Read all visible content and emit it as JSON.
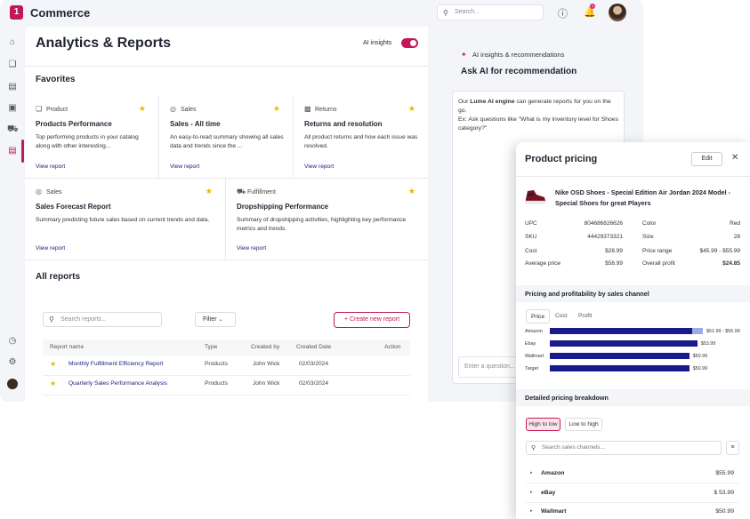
{
  "app": {
    "title": "Commerce",
    "logo_char": "1",
    "search_placeholder": "Search...",
    "notification_count": "1"
  },
  "page": {
    "title": "Analytics & Reports",
    "ai_insights_label": "AI insights",
    "ai_insights_on": true
  },
  "favorites": {
    "title": "Favorites",
    "cards": [
      {
        "category": "Product",
        "icon": "box-icon",
        "title": "Products Performance",
        "desc": "Top performing products in your catalog along with other interesting...",
        "link": "View report"
      },
      {
        "category": "Sales",
        "icon": "target-icon",
        "title": "Sales - All time",
        "desc": "An easy-to-read summary showing all sales data and trends since the ...",
        "link": "View report"
      },
      {
        "category": "Returns",
        "icon": "bank-icon",
        "title": "Returns and resolution",
        "desc": "All product returns and how each issue was resolved.",
        "link": "View report"
      },
      {
        "category": "Sales",
        "icon": "target-icon",
        "title": "Sales Forecast Report",
        "desc": "Summary predicting future sales based on current trends and data.",
        "link": "View report"
      },
      {
        "category": "Fulfillment",
        "icon": "truck-icon",
        "title": "Dropshipping Performance",
        "desc": "Summary of dropshipping activities, highlighting key performance metrics and trends.",
        "link": "View report"
      }
    ]
  },
  "all_reports": {
    "title": "All reports",
    "search_placeholder": "Search reports...",
    "filter_label": "Filter",
    "new_label": "+ Create new report",
    "columns": [
      "Report name",
      "Type",
      "Created by",
      "Created Date",
      "Action"
    ],
    "rows": [
      {
        "name": "Monthly Fulfillment Efficiency Report",
        "type": "Products",
        "by": "John Wick",
        "date": "02/03/2024"
      },
      {
        "name": "Quarterly Sales Performance Analysis",
        "type": "Products",
        "by": "John Wick",
        "date": "02/03/2024"
      }
    ]
  },
  "ai_panel": {
    "header": "AI insights & recommendations",
    "title": "Ask AI for recommendation",
    "msg_prefix": "Our ",
    "msg_bold": "Lume AI engine",
    "msg_rest": " can generate reports for you on the go.",
    "msg_example": "Ex: Ask questions like \"What is my inventory level for Shoes category?\"",
    "input_placeholder": "Enter a question..."
  },
  "product_pricing": {
    "title": "Product pricing",
    "edit_label": "Edit",
    "product_name": "Nike OSD Shoes - Special Edition Air Jordan 2024 Model - Special Shoes for great Players",
    "left_kv": [
      {
        "k": "UPC",
        "v": "804686826626"
      },
      {
        "k": "SKU",
        "v": "44429373321"
      },
      {
        "k": "Cost",
        "v": "$28.99"
      },
      {
        "k": "Average price",
        "v": "$58.99"
      }
    ],
    "right_kv": [
      {
        "k": "Color",
        "v": "Red"
      },
      {
        "k": "Size",
        "v": "28"
      },
      {
        "k": "Price range",
        "v": "$45.99 - $55.99"
      },
      {
        "k": "Overall profit",
        "v": "$24.85"
      }
    ],
    "channel_title": "Pricing and profitability by sales channel",
    "tabs": [
      "Price",
      "Cost",
      "Profit"
    ],
    "active_tab": "Price",
    "breakdown_title": "Detailed pricing breakdown",
    "sort_options": [
      "High to low",
      "Low to high"
    ],
    "active_sort": "High to low",
    "channel_search_placeholder": "Search sales channels...",
    "channels": [
      {
        "name": "Amazon",
        "value": "$55.99"
      },
      {
        "name": "eBay",
        "value": "$ 53.99"
      },
      {
        "name": "Wallmart",
        "value": "$50.99"
      }
    ]
  },
  "chart_data": {
    "type": "bar",
    "orientation": "horizontal",
    "categories": [
      "Amazon",
      "Ebay",
      "Wallmart",
      "Target"
    ],
    "series": [
      {
        "values": [
          51.99,
          53.99,
          50.99,
          50.99
        ],
        "color": "#1a1a8c"
      },
      {
        "values": [
          55.99,
          null,
          null,
          null
        ],
        "color": "#9fa8e8"
      }
    ],
    "labels": [
      "$51.99 - $55.99",
      "$53.99",
      "$50.99",
      "$50.99"
    ],
    "xlim": [
      0,
      60
    ]
  },
  "colors": {
    "accent": "#c2185b",
    "link": "#1a237e",
    "bar": "#1a1a8c",
    "bar_range": "#9fa8e8",
    "star": "#e6b800"
  }
}
